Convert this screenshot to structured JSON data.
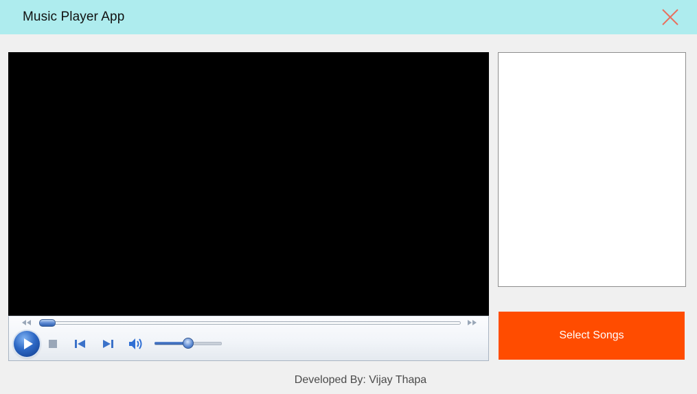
{
  "window": {
    "title": "Music Player App",
    "background": "#f0f0f0",
    "titlebar_color": "#aeecee",
    "close_icon": "close-icon",
    "close_color": "#e8705e"
  },
  "player": {
    "screen_color": "#000000",
    "seek_progress": 0.0,
    "volume_level": 0.5,
    "controls": [
      {
        "name": "play-button",
        "icon": "play-icon"
      },
      {
        "name": "stop-button",
        "icon": "stop-icon"
      },
      {
        "name": "previous-button",
        "icon": "skip-previous-icon"
      },
      {
        "name": "next-button",
        "icon": "skip-next-icon"
      },
      {
        "name": "mute-button",
        "icon": "speaker-icon"
      }
    ],
    "accent_color": "#2f6fd4"
  },
  "playlist": {
    "items": []
  },
  "actions": {
    "select_label": "Select Songs",
    "select_color": "#ff4c00"
  },
  "footer": {
    "credit": "Developed By: Vijay Thapa"
  }
}
